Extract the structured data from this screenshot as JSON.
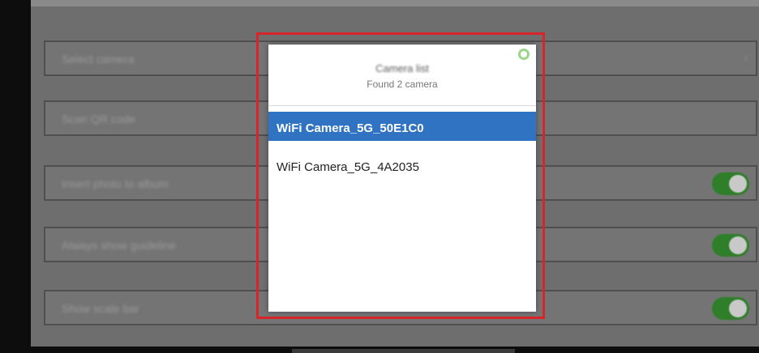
{
  "background_settings": {
    "rows": [
      {
        "label": "Select camera",
        "value": "",
        "control": "chevron"
      },
      {
        "label": "Scan QR code",
        "value": "",
        "control": "none"
      },
      {
        "label": "Insert photo to album",
        "value": "",
        "control": "toggle-on"
      },
      {
        "label": "Always show guideline",
        "value": "",
        "control": "toggle-on"
      },
      {
        "label": "Show scale bar",
        "value": "",
        "control": "toggle-on"
      }
    ]
  },
  "dialog": {
    "title": "Camera list",
    "subtitle": "Found 2 camera",
    "close_icon": "close-icon",
    "cameras": [
      {
        "name": "WiFi Camera_5G_50E1C0",
        "selected": true
      },
      {
        "name": "WiFi Camera_5G_4A2035",
        "selected": false
      }
    ]
  },
  "colors": {
    "selected_row": "#2f73c2",
    "highlight_border": "#d8252b",
    "toggle_on": "#2f7f2a"
  }
}
